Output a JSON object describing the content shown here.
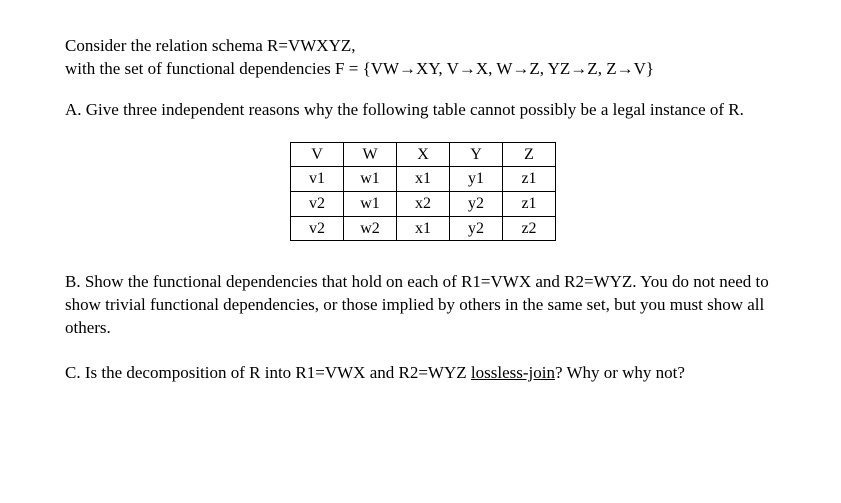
{
  "intro": {
    "line1": "Consider the relation schema R=VWXYZ,",
    "line2": "with the set of functional dependencies F = {VW→XY, V→X, W→Z, YZ→Z, Z→V}"
  },
  "partA": {
    "label": "A.   Give three independent reasons why the following table cannot possibly be a legal instance of R."
  },
  "table": {
    "headers": [
      "V",
      "W",
      "X",
      "Y",
      "Z"
    ],
    "rows": [
      [
        "v1",
        "w1",
        "x1",
        "y1",
        "z1"
      ],
      [
        "v2",
        "w1",
        "x2",
        "y2",
        "z1"
      ],
      [
        "v2",
        "w2",
        "x1",
        "y2",
        "z2"
      ]
    ]
  },
  "partB": {
    "label": "B.  Show the functional dependencies that hold on each of R1=VWX and R2=WYZ. You do not need to show trivial functional dependencies, or those implied by others in the same set, but you must show all others."
  },
  "partC": {
    "prefix": "C.  Is the decomposition of R into R1=VWX and R2=WYZ ",
    "underlined": "lossless-join",
    "suffix": "? Why or why not?"
  }
}
